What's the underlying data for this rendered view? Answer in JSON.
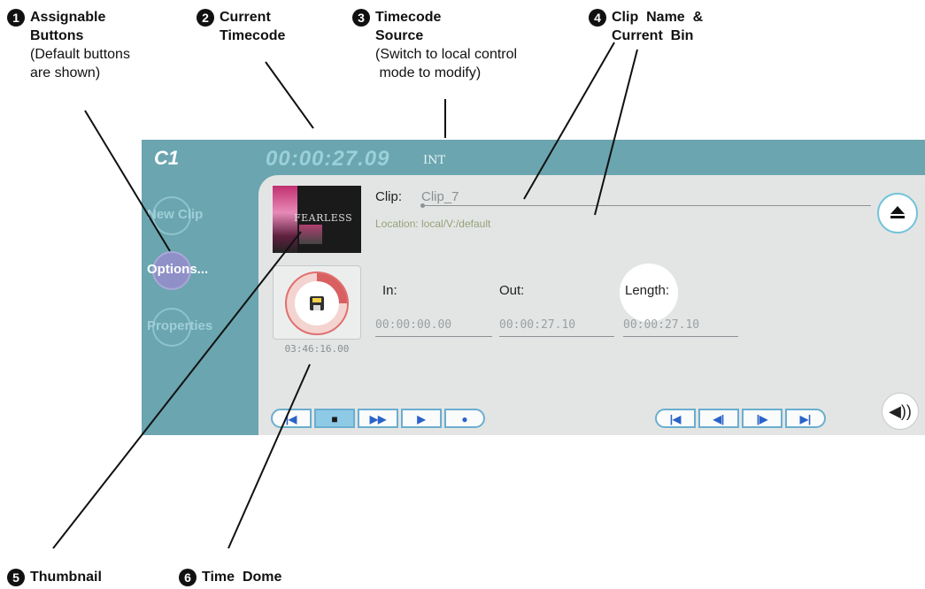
{
  "callouts": [
    {
      "num": "1",
      "title_lines": [
        "Assignable",
        "Buttons"
      ],
      "sub_lines": [
        "(Default buttons",
        "are shown)"
      ]
    },
    {
      "num": "2",
      "title_lines": [
        "Current",
        "Timecode"
      ],
      "sub_lines": []
    },
    {
      "num": "3",
      "title_lines": [
        "Timecode",
        "Source"
      ],
      "sub_lines": [
        "(Switch to local control",
        " mode to modify)"
      ]
    },
    {
      "num": "4",
      "title_lines": [
        "Clip  Name  &",
        "Current  Bin"
      ],
      "sub_lines": []
    },
    {
      "num": "5",
      "title_lines": [
        "Thumbnail"
      ],
      "sub_lines": []
    },
    {
      "num": "6",
      "title_lines": [
        "Time  Dome"
      ],
      "sub_lines": []
    }
  ],
  "panel": {
    "channel": "C1",
    "timecode": "00:00:27.09",
    "timecode_source": "INT",
    "side_buttons": [
      {
        "label": "New Clip",
        "active": false
      },
      {
        "label": "Options...",
        "active": true
      },
      {
        "label": "Properties",
        "active": false
      }
    ],
    "thumbnail_text": "FEARLESS",
    "clip": {
      "label": "Clip:",
      "value": "Clip_7"
    },
    "location": {
      "label": "Location:",
      "value": "local/V:/default"
    },
    "time_dome_value": "03:46:16.00",
    "fields": [
      {
        "label": "In:",
        "value": "00:00:00.00"
      },
      {
        "label": "Out:",
        "value": "00:00:27.10"
      },
      {
        "label": "Length:",
        "value": "00:00:27.10"
      }
    ],
    "transport_left": [
      {
        "icon": "go-to-start-icon",
        "glyph": "|◀"
      },
      {
        "icon": "stop-icon",
        "glyph": "■",
        "active": true
      },
      {
        "icon": "fast-forward-icon",
        "glyph": "▶▶"
      },
      {
        "icon": "play-icon",
        "glyph": "▶"
      },
      {
        "icon": "record-icon",
        "glyph": "●"
      }
    ],
    "transport_right": [
      {
        "icon": "go-to-start-icon",
        "glyph": "|◀"
      },
      {
        "icon": "step-back-icon",
        "glyph": "◀|"
      },
      {
        "icon": "step-forward-icon",
        "glyph": "|▶"
      },
      {
        "icon": "go-to-end-icon",
        "glyph": "▶|"
      }
    ],
    "eject_icon": "eject-icon",
    "speaker_icon": "speaker-icon",
    "speaker_glyph": "◀))"
  }
}
